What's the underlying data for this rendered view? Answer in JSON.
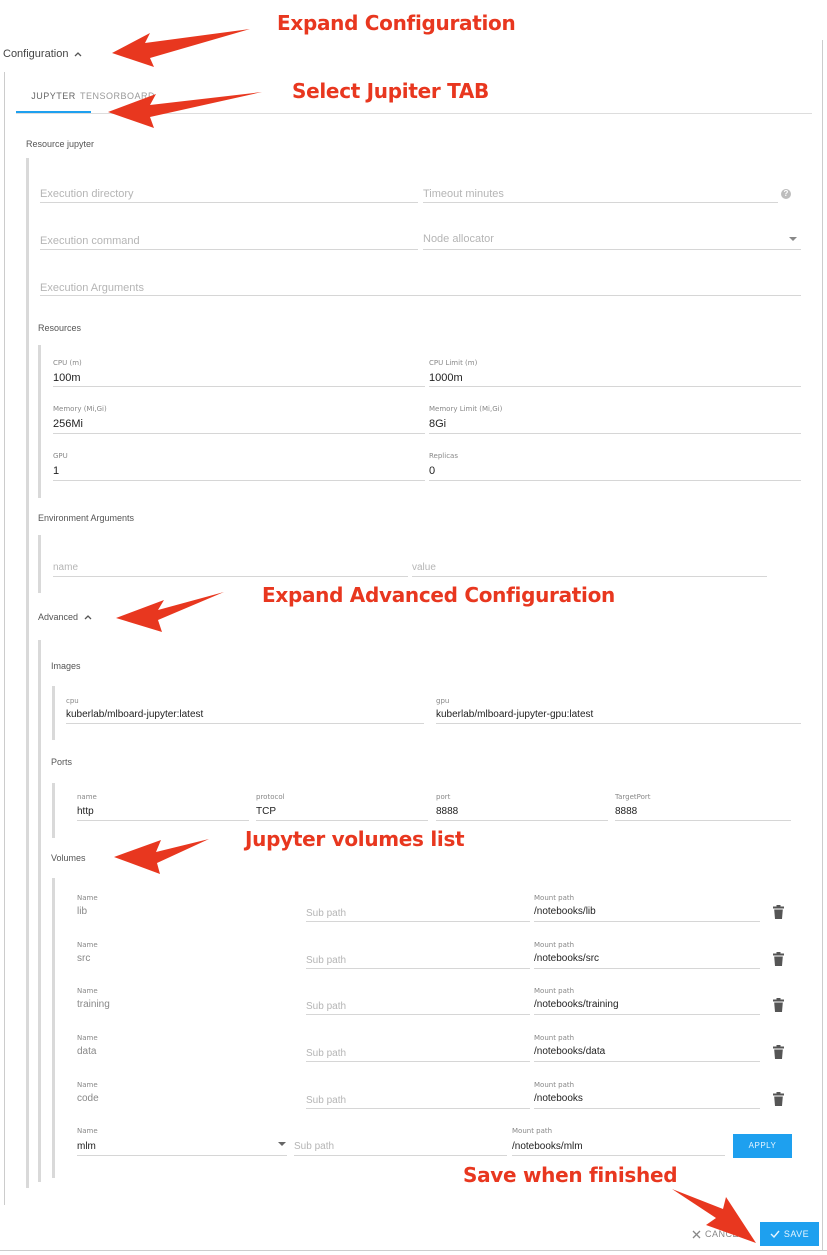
{
  "header": {
    "configuration_label": "Configuration"
  },
  "tabs": [
    {
      "label": "JUPYTER"
    },
    {
      "label": "TENSORBOARD"
    }
  ],
  "resource": {
    "title": "Resource jupyter",
    "execution_directory_placeholder": "Execution directory",
    "timeout_placeholder": "Timeout minutes",
    "execution_command_placeholder": "Execution command",
    "node_allocator_placeholder": "Node allocator",
    "execution_arguments_placeholder": "Execution Arguments"
  },
  "resources": {
    "title": "Resources",
    "cpu": {
      "label": "CPU (m)",
      "value": "100m"
    },
    "cpu_limit": {
      "label": "CPU Limit (m)",
      "value": "1000m"
    },
    "memory": {
      "label": "Memory (Mi,Gi)",
      "value": "256Mi"
    },
    "memory_limit": {
      "label": "Memory Limit (Mi,Gi)",
      "value": "8Gi"
    },
    "gpu": {
      "label": "GPU",
      "value": "1"
    },
    "replicas": {
      "label": "Replicas",
      "value": "0"
    }
  },
  "env": {
    "title": "Environment Arguments",
    "name_placeholder": "name",
    "value_placeholder": "value"
  },
  "advanced": {
    "label": "Advanced",
    "images": {
      "title": "Images",
      "cpu_label": "cpu",
      "cpu_value": "kuberlab/mlboard-jupyter:latest",
      "gpu_label": "gpu",
      "gpu_value": "kuberlab/mlboard-jupyter-gpu:latest"
    },
    "ports": {
      "title": "Ports",
      "name_label": "name",
      "name_value": "http",
      "protocol_label": "protocol",
      "protocol_value": "TCP",
      "port_label": "port",
      "port_value": "8888",
      "target_label": "TargetPort",
      "target_value": "8888"
    },
    "volumes": {
      "title": "Volumes",
      "name_label": "Name",
      "sub_path_placeholder": "Sub path",
      "mount_label": "Mount path",
      "items": [
        {
          "name": "lib",
          "mount": "/notebooks/lib"
        },
        {
          "name": "src",
          "mount": "/notebooks/src"
        },
        {
          "name": "training",
          "mount": "/notebooks/training"
        },
        {
          "name": "data",
          "mount": "/notebooks/data"
        },
        {
          "name": "code",
          "mount": "/notebooks"
        }
      ],
      "new_item": {
        "name": "mlm",
        "mount": "/notebooks/mlm"
      },
      "apply_label": "APPLY"
    }
  },
  "footer": {
    "cancel_label": "CANCEL",
    "save_label": "SAVE"
  },
  "annotations": {
    "expand_configuration": "Expand Configuration",
    "select_tab": "Select Jupiter TAB",
    "expand_advanced": "Expand Advanced Configuration",
    "volumes_list": "Jupyter volumes list",
    "save": "Save when finished"
  },
  "colors": {
    "accent": "#1ea0ef",
    "annotation": "#e8371f"
  }
}
